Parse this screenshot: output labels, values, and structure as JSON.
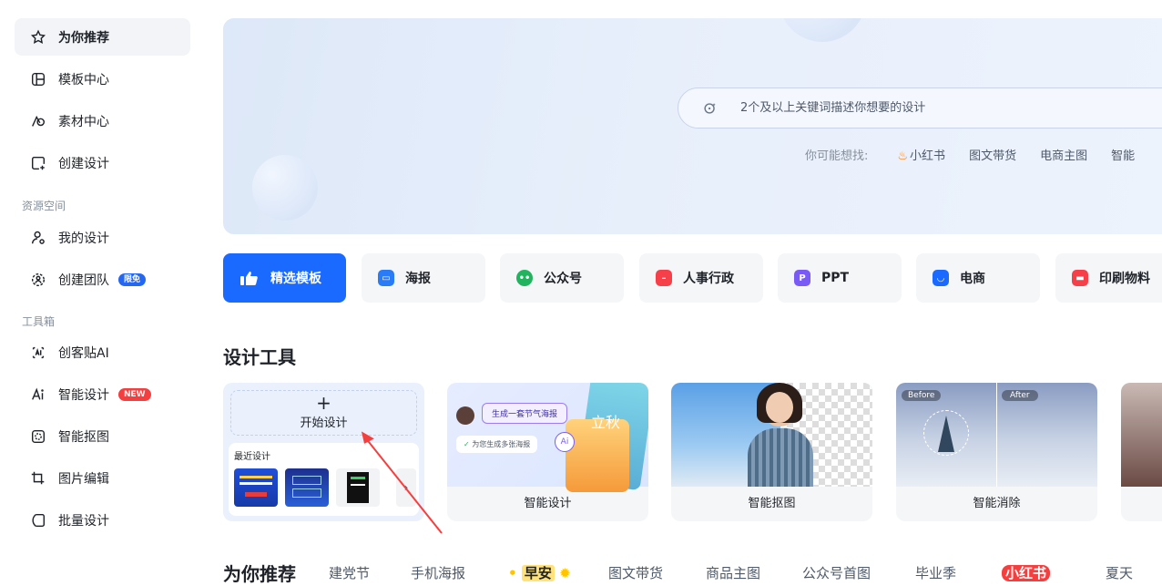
{
  "sidebar": {
    "items": [
      {
        "label": "为你推荐",
        "icon": "star-icon"
      },
      {
        "label": "模板中心",
        "icon": "template-icon"
      },
      {
        "label": "素材中心",
        "icon": "shapes-icon"
      },
      {
        "label": "创建设计",
        "icon": "create-icon"
      }
    ],
    "resource_label": "资源空间",
    "resource_items": [
      {
        "label": "我的设计",
        "icon": "user-icon"
      },
      {
        "label": "创建团队",
        "icon": "team-icon",
        "badge": "限免"
      }
    ],
    "toolbox_label": "工具箱",
    "toolbox_items": [
      {
        "label": "创客贴AI",
        "icon": "ai-icon"
      },
      {
        "label": "智能设计",
        "icon": "ai-design-icon",
        "badge": "NEW"
      },
      {
        "label": "智能抠图",
        "icon": "cutout-icon"
      },
      {
        "label": "图片编辑",
        "icon": "crop-icon"
      },
      {
        "label": "批量设计",
        "icon": "batch-icon"
      }
    ]
  },
  "search": {
    "placeholder": "2个及以上关键词描述你想要的设计",
    "hint_label": "你可能想找:",
    "hints": [
      "小红书",
      "图文带货",
      "电商主图",
      "智能"
    ]
  },
  "categories": [
    {
      "label": "精选模板",
      "color": "#ffffff"
    },
    {
      "label": "海报",
      "color": "#2a7bf6"
    },
    {
      "label": "公众号",
      "color": "#22b35e"
    },
    {
      "label": "人事行政",
      "color": "#f5404a"
    },
    {
      "label": "PPT",
      "color": "#7a5af5"
    },
    {
      "label": "电商",
      "color": "#1a6aff"
    },
    {
      "label": "印刷物料",
      "color": "#f5404a"
    }
  ],
  "tools": {
    "title": "设计工具",
    "start_label": "开始设计",
    "recent_label": "最近设计",
    "cards": [
      "智能设计",
      "智能抠图",
      "智能消除"
    ],
    "card1_bubble1": "生成一套节气海报",
    "card1_bubble2": "为您生成多张海报",
    "card1_poster": "立秋",
    "before_label": "Before",
    "after_label": "After"
  },
  "recommend": {
    "title": "为你推荐",
    "tabs": [
      "建党节",
      "手机海报",
      "早安",
      "图文带货",
      "商品主图",
      "公众号首图",
      "毕业季",
      "小红书",
      "夏天"
    ]
  }
}
